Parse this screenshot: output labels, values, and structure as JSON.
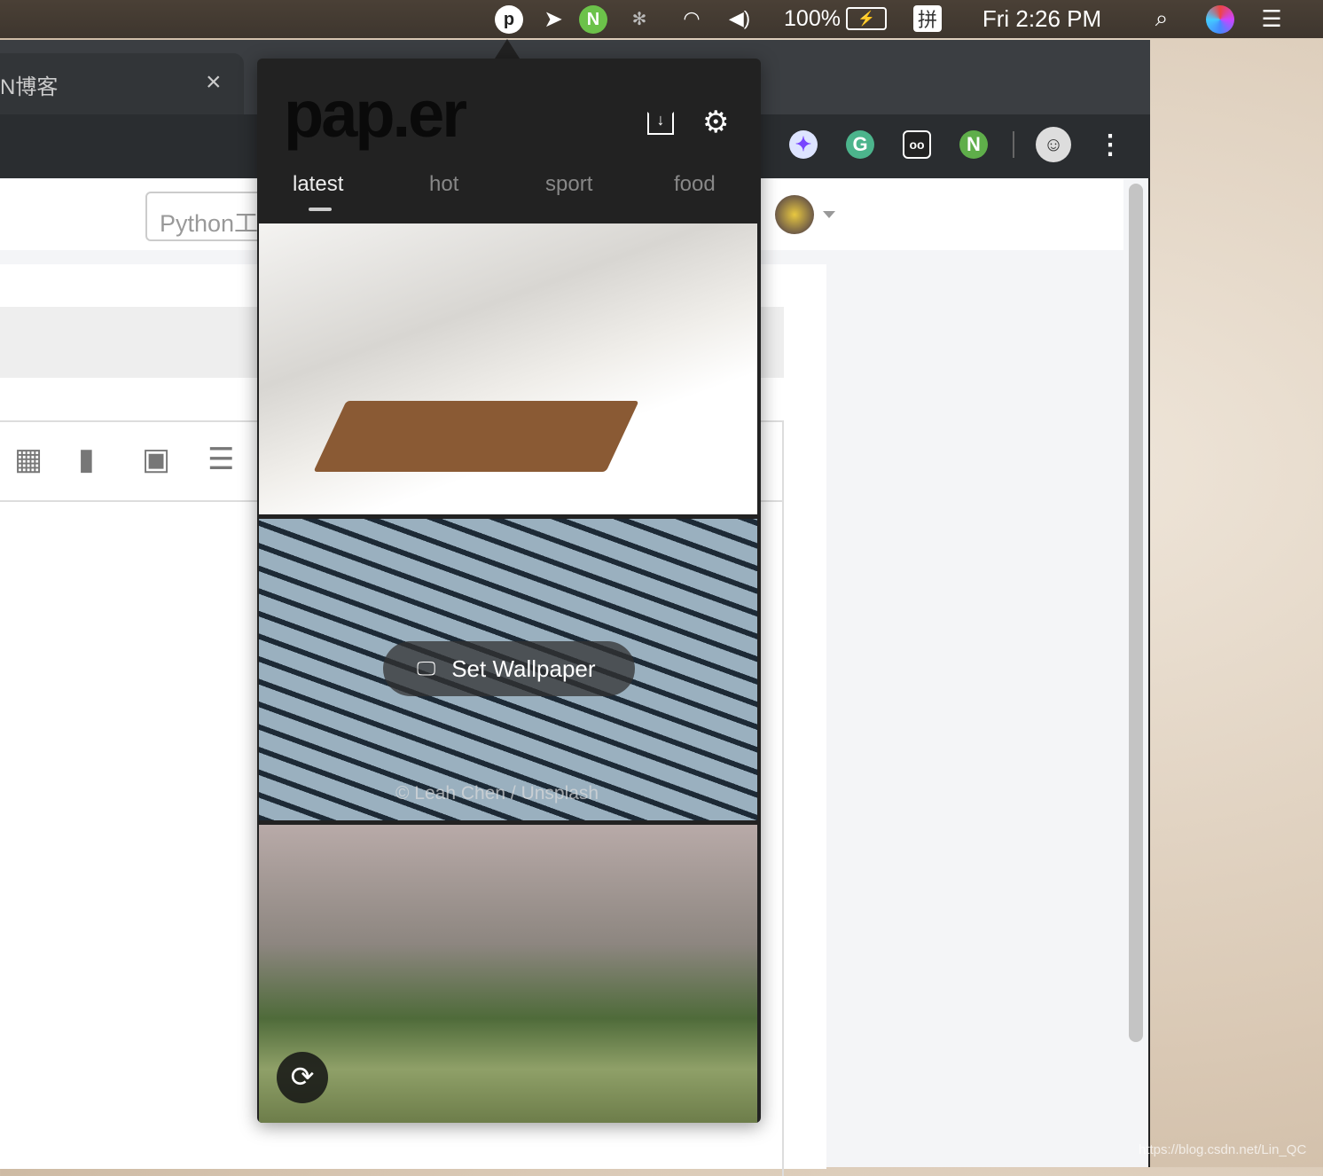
{
  "menubar": {
    "battery": "100%",
    "input_method": "拼",
    "clock": "Fri 2:26 PM",
    "icons": [
      "paper-icon",
      "paper-plane-icon",
      "n-icon",
      "bluetooth-icon",
      "wifi-icon",
      "volume-icon",
      "battery-charging-icon",
      "search-icon",
      "siri-icon",
      "list-icon"
    ]
  },
  "browser": {
    "tab_title": "N博客",
    "tab_close": "×",
    "search_value": "Python工",
    "extensions": [
      "kiwi-icon",
      "grammarly-icon",
      "glasses-icon",
      "n-icon"
    ],
    "menu": "⋮"
  },
  "popup": {
    "logo": "pap.er",
    "tabs": [
      {
        "label": "latest",
        "active": true
      },
      {
        "label": "hot"
      },
      {
        "label": "sport"
      },
      {
        "label": "food"
      }
    ],
    "set_wallpaper": "Set Wallpaper",
    "credit": "© Leah Chen / Unsplash",
    "accent": "#ffffff"
  },
  "watermark": "https://blog.csdn.net/Lin_QC"
}
